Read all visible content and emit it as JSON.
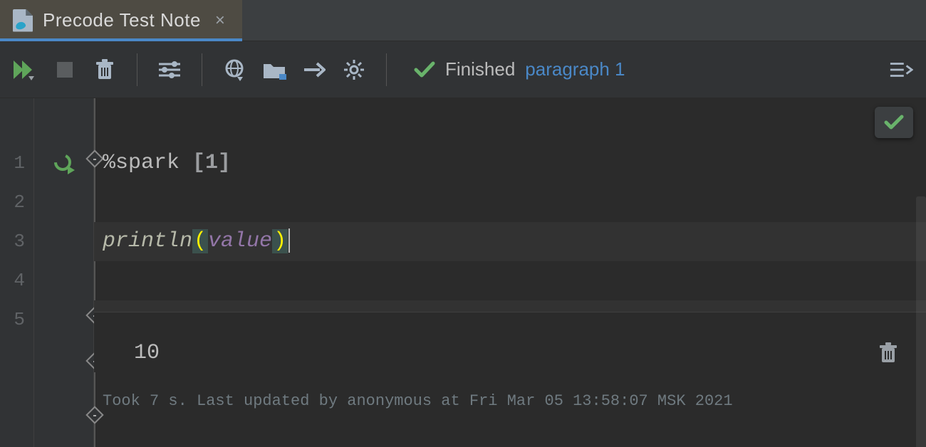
{
  "tab": {
    "title": "Precode Test Note"
  },
  "status": {
    "text": "Finished",
    "link": "paragraph 1"
  },
  "code": {
    "magic": "%spark",
    "index": "[1]",
    "fn": "println",
    "arg": "value"
  },
  "line_numbers": [
    "1",
    "2",
    "3",
    "4",
    "5"
  ],
  "output": {
    "value": "10"
  },
  "meta": "Took 7 s. Last updated by anonymous at Fri Mar 05 13:58:07 MSK 2021"
}
